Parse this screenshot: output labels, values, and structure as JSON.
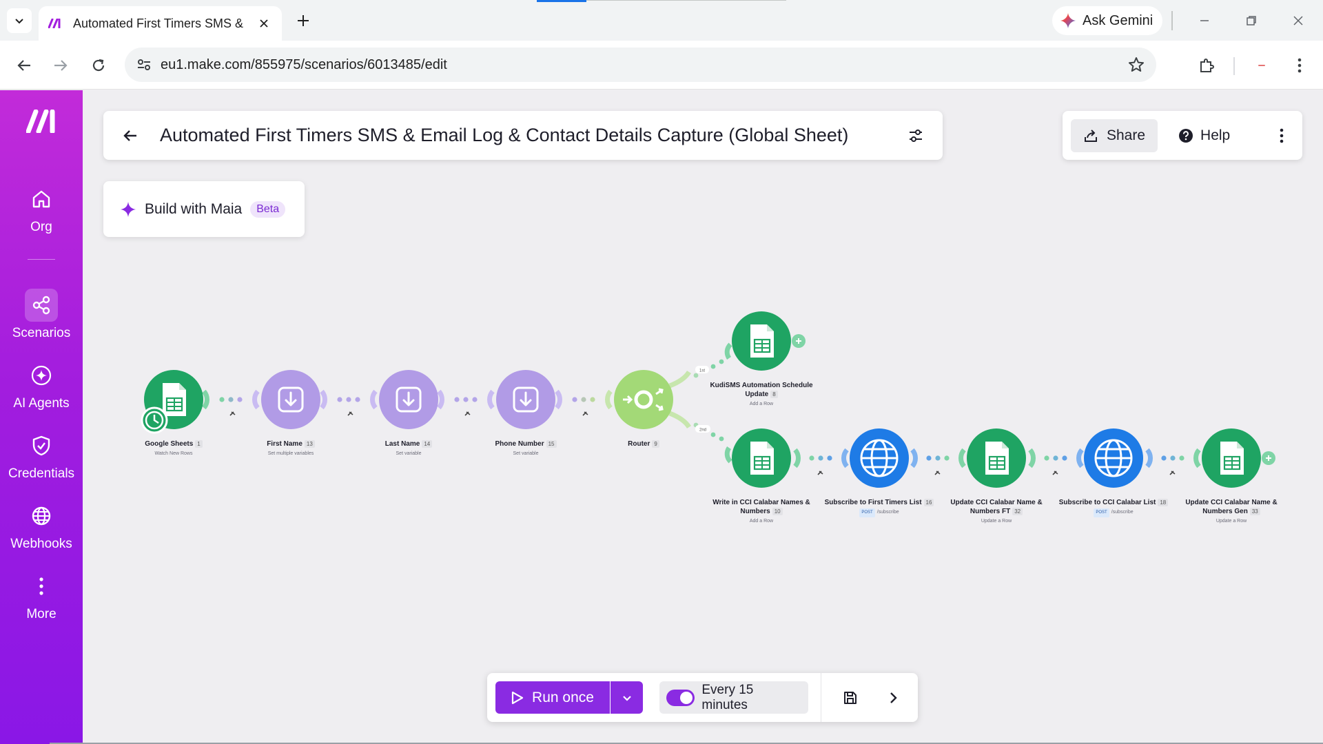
{
  "browser": {
    "tab_title": "Automated First Timers SMS & Email Log & Contact Details Capture (Global Sheet)",
    "url": "eu1.make.com/855975/scenarios/6013485/edit",
    "gemini_label": "Ask Gemini"
  },
  "sidebar": {
    "items": [
      {
        "label": "Org",
        "icon": "home-icon"
      },
      {
        "label": "Scenarios",
        "icon": "scenarios-icon",
        "active": true
      },
      {
        "label": "AI Agents",
        "icon": "ai-agents-icon"
      },
      {
        "label": "Credentials",
        "icon": "shield-icon"
      },
      {
        "label": "Webhooks",
        "icon": "globe-icon"
      },
      {
        "label": "More",
        "icon": "more-vertical-icon"
      }
    ]
  },
  "header": {
    "title": "Automated First Timers SMS & Email Log & Contact Details Capture (Global Sheet)",
    "share_label": "Share",
    "help_label": "Help"
  },
  "maia": {
    "label": "Build with Maia",
    "badge": "Beta"
  },
  "modules": [
    {
      "name": "Google Sheets",
      "id": "1",
      "action": "Watch New Rows",
      "type": "sheets"
    },
    {
      "name": "First Name",
      "id": "13",
      "action": "Set multiple variables",
      "type": "tools"
    },
    {
      "name": "Last Name",
      "id": "14",
      "action": "Set variable",
      "type": "tools"
    },
    {
      "name": "Phone Number",
      "id": "15",
      "action": "Set variable",
      "type": "tools"
    },
    {
      "name": "Router",
      "id": "9",
      "action": "",
      "type": "router"
    },
    {
      "name": "KudiSMS Automation Schedule Update",
      "id": "8",
      "action": "Add a Row",
      "type": "sheets"
    },
    {
      "name": "Write in CCI Calabar Names & Numbers",
      "id": "10",
      "action": "Add a Row",
      "type": "sheets"
    },
    {
      "name": "Subscribe to First Timers List",
      "id": "16",
      "method": "POST",
      "action": "/subscribe",
      "type": "http"
    },
    {
      "name": "Update CCI Calabar Name & Numbers FT",
      "id": "32",
      "action": "Update a Row",
      "type": "sheets"
    },
    {
      "name": "Subscribe to CCI Calabar List",
      "id": "18",
      "method": "POST",
      "action": "/subscribe",
      "type": "http"
    },
    {
      "name": "Update CCI Calabar Name & Numbers Gen",
      "id": "33",
      "action": "Update a Row",
      "type": "sheets"
    }
  ],
  "routes": [
    "1st",
    "2nd"
  ],
  "bottom_bar": {
    "run_label": "Run once",
    "schedule_label": "Every 15 minutes",
    "schedule_on": true
  },
  "colors": {
    "sheets_green": "#1fa463",
    "tools_purple": "#b19be6",
    "router_green": "#a3d977",
    "http_blue": "#1e7be6",
    "brand_purple": "#8a2be2"
  }
}
